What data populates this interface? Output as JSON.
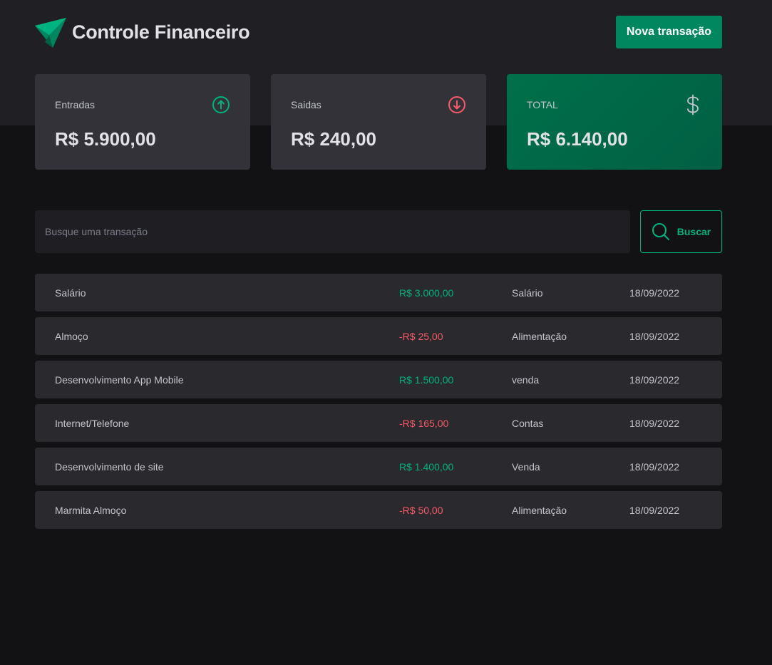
{
  "app": {
    "title": "Controle Financeiro",
    "new_transaction_label": "Nova transação"
  },
  "colors": {
    "accent": "#00875f",
    "income": "#00b37e",
    "outcome": "#f75a68"
  },
  "summary": {
    "income": {
      "label": "Entradas",
      "value": "R$ 5.900,00",
      "icon": "arrow-circle-up-icon"
    },
    "outcome": {
      "label": "Saidas",
      "value": "R$ 240,00",
      "icon": "arrow-circle-down-icon"
    },
    "total": {
      "label": "TOTAL",
      "value": "R$ 6.140,00",
      "icon": "currency-dollar-icon"
    }
  },
  "search": {
    "placeholder": "Busque uma transação",
    "button_label": "Buscar",
    "icon": "magnifying-glass-icon"
  },
  "transactions": [
    {
      "description": "Salário",
      "price": "R$ 3.000,00",
      "type": "income",
      "category": "Salário",
      "date": "18/09/2022"
    },
    {
      "description": "Almoço",
      "price": "-R$ 25,00",
      "type": "outcome",
      "category": "Alimentação",
      "date": "18/09/2022"
    },
    {
      "description": "Desenvolvimento App Mobile",
      "price": "R$ 1.500,00",
      "type": "income",
      "category": "venda",
      "date": "18/09/2022"
    },
    {
      "description": "Internet/Telefone",
      "price": "-R$ 165,00",
      "type": "outcome",
      "category": "Contas",
      "date": "18/09/2022"
    },
    {
      "description": "Desenvolvimento de site",
      "price": "R$ 1.400,00",
      "type": "income",
      "category": "Venda",
      "date": "18/09/2022"
    },
    {
      "description": "Marmita Almoço",
      "price": "-R$ 50,00",
      "type": "outcome",
      "category": "Alimentação",
      "date": "18/09/2022"
    }
  ]
}
